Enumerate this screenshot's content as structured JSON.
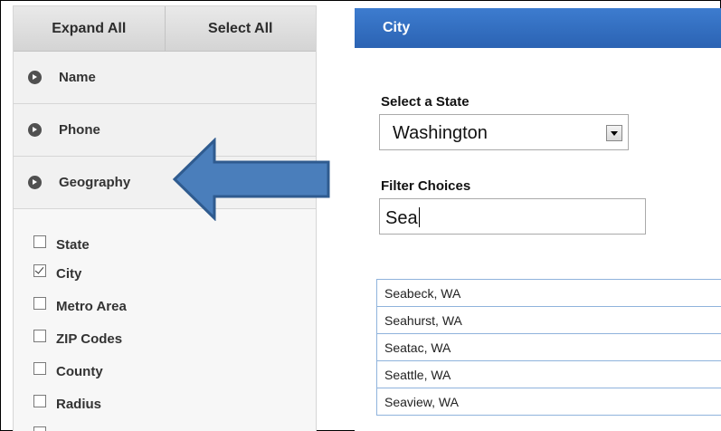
{
  "left_panel": {
    "expand_all": "Expand All",
    "select_all": "Select All",
    "sections": [
      "Name",
      "Phone",
      "Geography"
    ],
    "checkboxes": [
      {
        "label": "State",
        "checked": false
      },
      {
        "label": "City",
        "checked": true
      },
      {
        "label": "Metro Area",
        "checked": false
      },
      {
        "label": "ZIP Codes",
        "checked": false
      },
      {
        "label": "County",
        "checked": false
      },
      {
        "label": "Radius",
        "checked": false
      }
    ]
  },
  "right_panel": {
    "title": "City",
    "state_label": "Select a State",
    "state_value": "Washington",
    "filter_label": "Filter Choices",
    "filter_value": "Sea",
    "results": [
      "Seabeck, WA",
      "Seahurst, WA",
      "Seatac, WA",
      "Seattle, WA",
      "Seaview, WA"
    ]
  },
  "colors": {
    "header_blue": "#2b63b3",
    "arrow_blue": "#4a7ebb",
    "list_border": "#8fb3dc"
  }
}
